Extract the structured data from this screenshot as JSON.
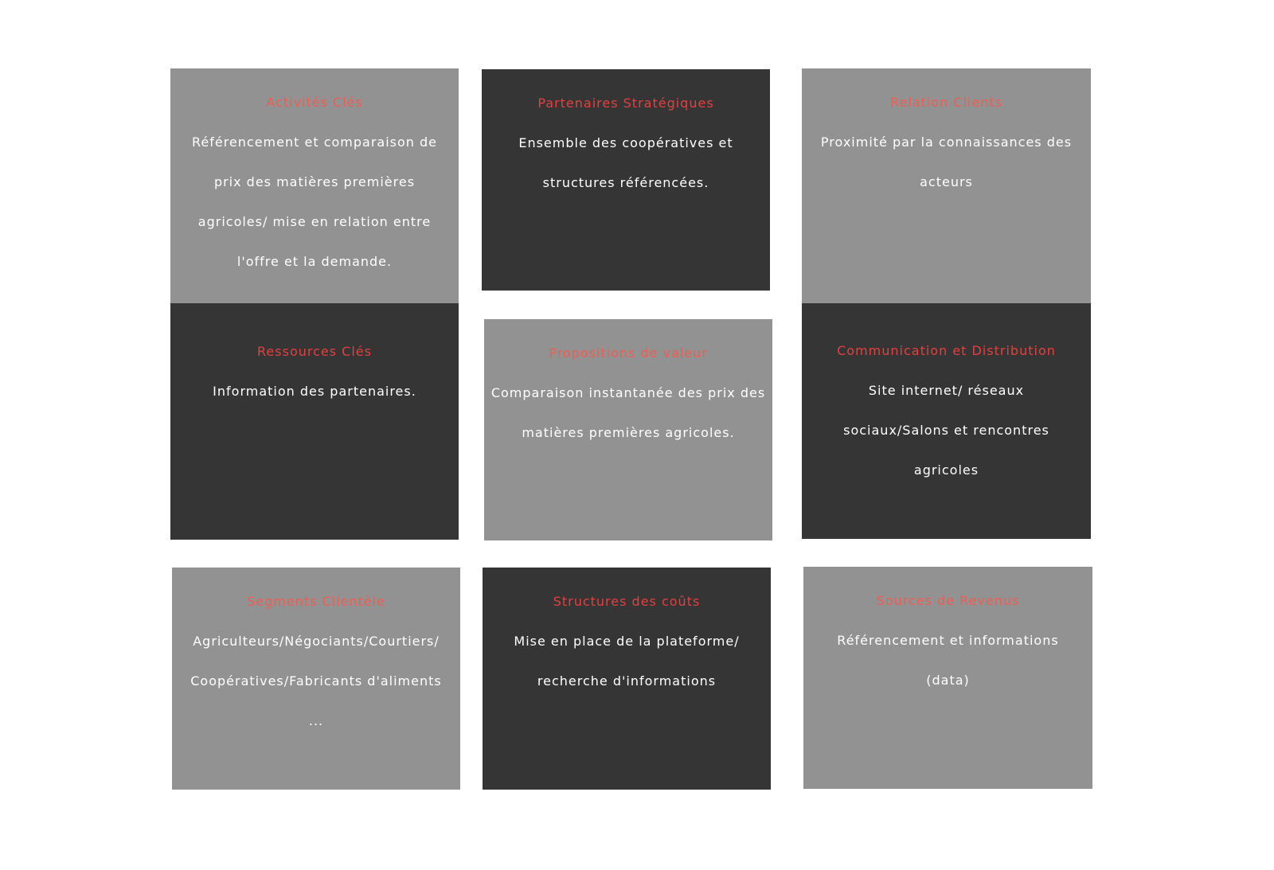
{
  "colors": {
    "title": "#e3403f",
    "title_muted": "#ec5e54",
    "light_tile": "#929292",
    "dark_tile": "#353535",
    "body_text": "#ffffff"
  },
  "tiles": {
    "activites": {
      "title": "Activités Clés",
      "body": "Référencement et comparaison de\nprix des matières premières\nagricoles/ mise en relation entre\nl'offre et la demande."
    },
    "partenaires": {
      "title": "Partenaires Stratégiques",
      "body": "Ensemble des coopératives et\nstructures référencées."
    },
    "relation": {
      "title": "Relation Clients",
      "body": "Proximité par la connaissances des\nacteurs"
    },
    "ressources": {
      "title": "Ressources Clés",
      "body": "Information des partenaires."
    },
    "propositions": {
      "title": "Propositions de valeur",
      "body": "Comparaison instantanée des prix des\nmatières premières agricoles."
    },
    "communication": {
      "title": "Communication et Distribution",
      "body": "Site internet/ réseaux\nsociaux/Salons et rencontres\nagricoles"
    },
    "segments": {
      "title": "Segments Clientèle",
      "body": "Agriculteurs/Négociants/Courtiers/\nCoopératives/Fabricants d'aliments\n..."
    },
    "couts": {
      "title": "Structures des coûts",
      "body": "Mise en place de la plateforme/\nrecherche d'informations"
    },
    "sources": {
      "title": "Sources de Revenus",
      "body": "Référencement et informations\n(data)"
    }
  }
}
